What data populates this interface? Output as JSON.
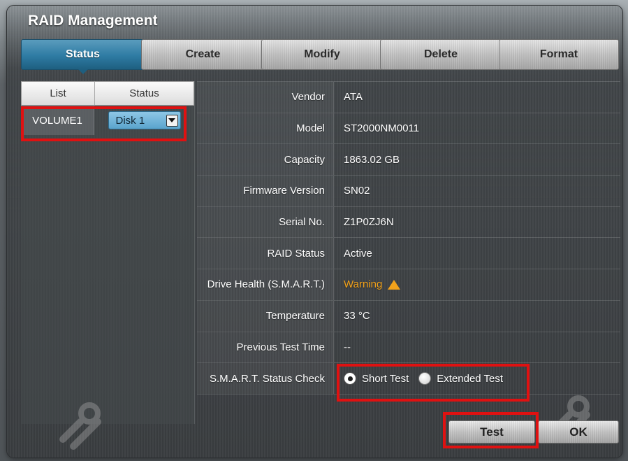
{
  "window": {
    "title": "RAID Management"
  },
  "tabs": [
    {
      "label": "Status",
      "active": true
    },
    {
      "label": "Create",
      "active": false
    },
    {
      "label": "Modify",
      "active": false
    },
    {
      "label": "Delete",
      "active": false
    },
    {
      "label": "Format",
      "active": false
    }
  ],
  "list": {
    "headers": {
      "list": "List",
      "status": "Status"
    },
    "rows": [
      {
        "name": "VOLUME1",
        "disk": "Disk 1"
      }
    ]
  },
  "details": {
    "rows": [
      {
        "label": "Vendor",
        "value": "ATA"
      },
      {
        "label": "Model",
        "value": "ST2000NM0011"
      },
      {
        "label": "Capacity",
        "value": "1863.02 GB"
      },
      {
        "label": "Firmware Version",
        "value": "SN02"
      },
      {
        "label": "Serial No.",
        "value": "Z1P0ZJ6N"
      },
      {
        "label": "RAID Status",
        "value": "Active"
      },
      {
        "label": "Drive Health (S.M.A.R.T.)",
        "value": "Warning"
      },
      {
        "label": "Temperature",
        "value": "33 °C"
      },
      {
        "label": "Previous Test Time",
        "value": "--"
      },
      {
        "label": "S.M.A.R.T. Status Check",
        "value": ""
      }
    ],
    "smart_options": [
      {
        "label": "Short Test",
        "selected": true
      },
      {
        "label": "Extended Test",
        "selected": false
      }
    ],
    "warning_color": "#f2a21b"
  },
  "buttons": {
    "test": "Test",
    "ok": "OK"
  },
  "colors": {
    "active_tab": "#2e7ba3",
    "highlight": "#e01111"
  }
}
